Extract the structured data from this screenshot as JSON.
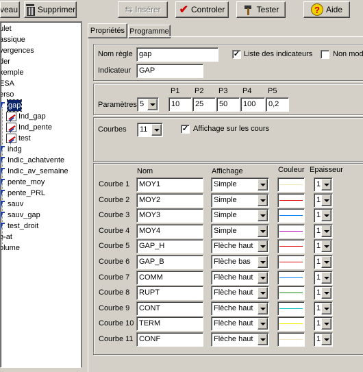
{
  "toolbar": {
    "nouveau_label": "veau",
    "supprimer_label": "Supprimer",
    "inserer_label": "Insérer",
    "controler_label": "Controler",
    "tester_label": "Tester",
    "aide_label": "Aide",
    "help_glyph": "?"
  },
  "tree": {
    "items": [
      {
        "label": "ulet",
        "icon": "none"
      },
      {
        "label": "assique",
        "icon": "none"
      },
      {
        "label": "vergences",
        "icon": "none"
      },
      {
        "label": "der",
        "icon": "none"
      },
      {
        "label": "xemple",
        "icon": "none"
      },
      {
        "label": "ESA",
        "icon": "none"
      },
      {
        "label": "erso",
        "icon": "none"
      },
      {
        "label": "gap",
        "icon": "function-icon",
        "selected": true
      },
      {
        "label": "Ind_gap",
        "icon": "indicator-icon"
      },
      {
        "label": "Ind_pente",
        "icon": "indicator-icon"
      },
      {
        "label": "test",
        "icon": "indicator-icon"
      },
      {
        "label": "indg",
        "icon": "function-icon"
      },
      {
        "label": "Indic_achatvente",
        "icon": "function-icon"
      },
      {
        "label": "Indic_av_semaine",
        "icon": "function-icon"
      },
      {
        "label": "pente_moy",
        "icon": "function-icon"
      },
      {
        "label": "pente_PRL",
        "icon": "function-icon"
      },
      {
        "label": "sauv",
        "icon": "function-icon"
      },
      {
        "label": "sauv_gap",
        "icon": "function-icon"
      },
      {
        "label": "test_droit",
        "icon": "function-icon"
      },
      {
        "label": "o-at",
        "icon": "none"
      },
      {
        "label": "olume",
        "icon": "none"
      }
    ]
  },
  "tabs": [
    {
      "label": "Propriétés",
      "active": true
    },
    {
      "label": "Programme",
      "active": false
    }
  ],
  "form": {
    "nom_regle_label": "Nom règle",
    "nom_regle_value": "gap",
    "liste_indicateurs_label": "Liste des indicateurs",
    "liste_indicateurs_checked": true,
    "non_mod_label": "Non mod",
    "non_mod_checked": false,
    "indicateur_label": "Indicateur",
    "indicateur_value": "GAP",
    "check_glyph": "✓",
    "parametres_label": "Paramètres",
    "parametres_count": "5",
    "params": [
      {
        "label": "P1",
        "value": "10"
      },
      {
        "label": "P2",
        "value": "25"
      },
      {
        "label": "P3",
        "value": "50"
      },
      {
        "label": "P4",
        "value": "100"
      },
      {
        "label": "P5",
        "value": "0,2"
      }
    ],
    "courbes_label": "Courbes",
    "courbes_count": "11",
    "affichage_cours_label": "Affichage sur les cours",
    "affichage_cours_checked": true
  },
  "curves": {
    "headers": {
      "nom": "Nom",
      "affichage": "Affichage",
      "couleur": "Couleur",
      "epaisseur": "Epaisseur"
    },
    "rows": [
      {
        "label": "Courbe 1",
        "nom": "MOY1",
        "affichage": "Simple",
        "color": "#f0e6c0",
        "epaisseur": "1"
      },
      {
        "label": "Courbe 2",
        "nom": "MOY2",
        "affichage": "Simple",
        "color": "#e00000",
        "epaisseur": "1"
      },
      {
        "label": "Courbe 3",
        "nom": "MOY3",
        "affichage": "Simple",
        "color": "#0080ff",
        "epaisseur": "1"
      },
      {
        "label": "Courbe 4",
        "nom": "MOY4",
        "affichage": "Simple",
        "color": "#c000c0",
        "epaisseur": "1"
      },
      {
        "label": "Courbe 5",
        "nom": "GAP_H",
        "affichage": "Flèche haut",
        "color": "#e00000",
        "epaisseur": "1"
      },
      {
        "label": "Courbe 6",
        "nom": "GAP_B",
        "affichage": "Flèche bas",
        "color": "#e00000",
        "epaisseur": "1"
      },
      {
        "label": "Courbe 7",
        "nom": "COMM",
        "affichage": "Flèche haut",
        "color": "#0080ff",
        "epaisseur": "1"
      },
      {
        "label": "Courbe 8",
        "nom": "RUPT",
        "affichage": "Flèche haut",
        "color": "#008000",
        "epaisseur": "1"
      },
      {
        "label": "Courbe 9",
        "nom": "CONT",
        "affichage": "Flèche haut",
        "color": "#00c0c0",
        "epaisseur": "1"
      },
      {
        "label": "Courbe 10",
        "nom": "TERM",
        "affichage": "Flèche haut",
        "color": "#f0f000",
        "epaisseur": "1"
      },
      {
        "label": "Courbe 11",
        "nom": "CONF",
        "affichage": "Flèche haut",
        "color": "#f0e6c0",
        "epaisseur": "1"
      }
    ]
  }
}
